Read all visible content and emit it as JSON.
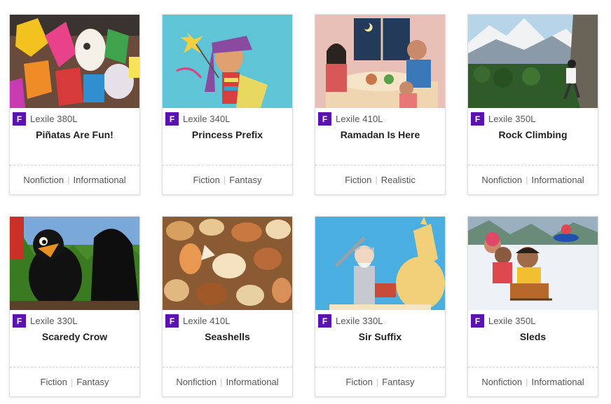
{
  "books": [
    {
      "level": "F",
      "lexile": "Lexile 380L",
      "title": "Piñatas Are Fun!",
      "genre_a": "Nonfiction",
      "genre_b": "Informational",
      "separator": "|"
    },
    {
      "level": "F",
      "lexile": "Lexile 340L",
      "title": "Princess Prefix",
      "genre_a": "Fiction",
      "genre_b": "Fantasy",
      "separator": "|"
    },
    {
      "level": "F",
      "lexile": "Lexile 410L",
      "title": "Ramadan Is Here",
      "genre_a": "Fiction",
      "genre_b": "Realistic",
      "separator": "|"
    },
    {
      "level": "F",
      "lexile": "Lexile 350L",
      "title": "Rock Climbing",
      "genre_a": "Nonfiction",
      "genre_b": "Informational",
      "separator": "|"
    },
    {
      "level": "F",
      "lexile": "Lexile 330L",
      "title": "Scaredy Crow",
      "genre_a": "Fiction",
      "genre_b": "Fantasy",
      "separator": "|"
    },
    {
      "level": "F",
      "lexile": "Lexile 410L",
      "title": "Seashells",
      "genre_a": "Nonfiction",
      "genre_b": "Informational",
      "separator": "|"
    },
    {
      "level": "F",
      "lexile": "Lexile 330L",
      "title": "Sir Suffix",
      "genre_a": "Fiction",
      "genre_b": "Fantasy",
      "separator": "|"
    },
    {
      "level": "F",
      "lexile": "Lexile 350L",
      "title": "Sleds",
      "genre_a": "Nonfiction",
      "genre_b": "Informational",
      "separator": "|"
    }
  ],
  "colors": {
    "level_badge": "#5b13b0"
  }
}
